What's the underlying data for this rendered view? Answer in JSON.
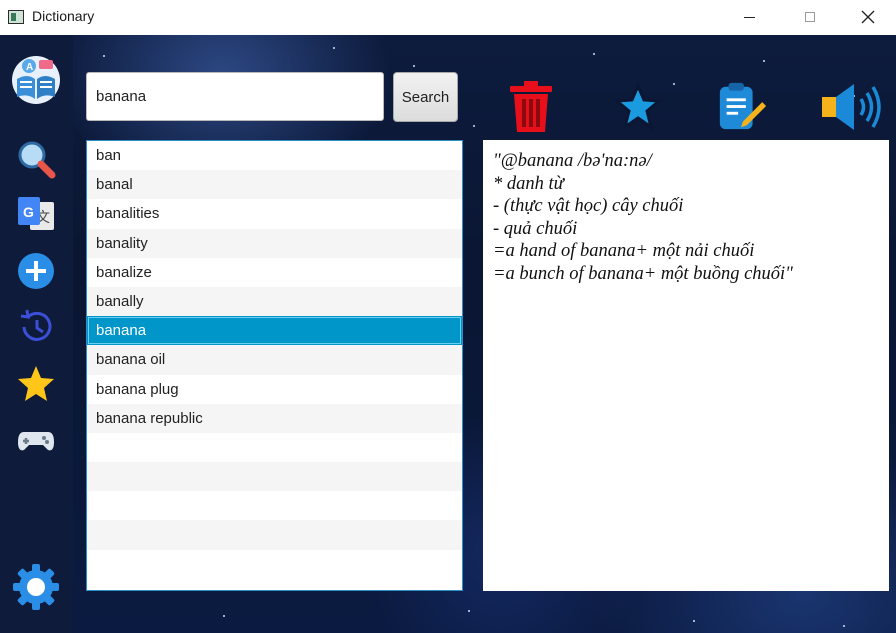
{
  "window": {
    "title": "Dictionary"
  },
  "sidebar": {
    "items": [
      {
        "name": "dictionary-logo-icon"
      },
      {
        "name": "search-icon"
      },
      {
        "name": "translate-icon"
      },
      {
        "name": "add-icon"
      },
      {
        "name": "history-icon"
      },
      {
        "name": "favorites-star-icon"
      },
      {
        "name": "game-controller-icon"
      },
      {
        "name": "settings-gear-icon"
      }
    ]
  },
  "search": {
    "value": "banana",
    "button_label": "Search"
  },
  "word_list": {
    "items": [
      "ban",
      "banal",
      "banalities",
      "banality",
      "banalize",
      "banally",
      "banana",
      "banana oil",
      "banana plug",
      "banana republic"
    ],
    "selected": "banana",
    "empty_rows": 5
  },
  "toolbar": {
    "icons": [
      "delete-trash-icon",
      "favorite-star-icon",
      "edit-note-icon",
      "speaker-icon"
    ],
    "colors": {
      "trash": "#e60f1a",
      "star": "#1a9be0",
      "edit": "#1f8ad8",
      "speaker": "#1a8ad8"
    }
  },
  "definition": {
    "lines": [
      "\"@banana /bə'na:nə/",
      "* danh từ",
      "- (thực vật học) cây chuối",
      "- quả chuối",
      "=a hand of banana+ một nải chuối",
      "=a bunch of banana+ một buồng chuối\""
    ]
  }
}
